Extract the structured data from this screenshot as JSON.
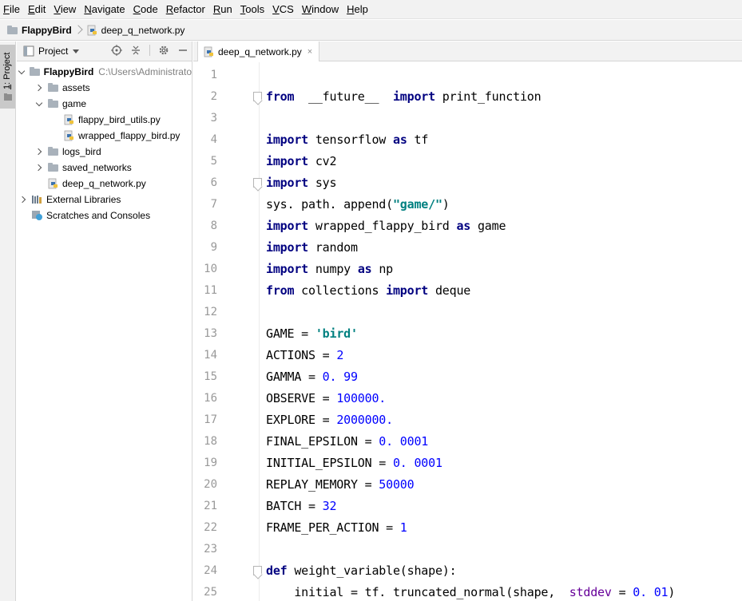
{
  "menu": [
    {
      "label": "File",
      "mn": "F",
      "rest": "ile"
    },
    {
      "label": "Edit",
      "mn": "E",
      "rest": "dit"
    },
    {
      "label": "View",
      "mn": "V",
      "rest": "iew"
    },
    {
      "label": "Navigate",
      "mn": "N",
      "rest": "avigate"
    },
    {
      "label": "Code",
      "mn": "C",
      "rest": "ode"
    },
    {
      "label": "Refactor",
      "mn": "R",
      "rest": "efactor"
    },
    {
      "label": "Run",
      "mn": "R",
      "rest": "un"
    },
    {
      "label": "Tools",
      "mn": "T",
      "rest": "ools"
    },
    {
      "label": "VCS",
      "mn": "V",
      "rest": "CS"
    },
    {
      "label": "Window",
      "mn": "W",
      "rest": "indow"
    },
    {
      "label": "Help",
      "mn": "H",
      "rest": "elp"
    }
  ],
  "breadcrumb": {
    "project": "FlappyBird",
    "file": "deep_q_network.py"
  },
  "left_stripe": {
    "tab_number": "1",
    "tab_label": ": Project"
  },
  "project_panel": {
    "title": "Project",
    "tree": [
      {
        "label": "FlappyBird",
        "hint": "C:\\Users\\Administrato",
        "type": "root",
        "expanded": true,
        "depth": 0
      },
      {
        "label": "assets",
        "type": "folder",
        "expanded": false,
        "depth": 1
      },
      {
        "label": "game",
        "type": "folder",
        "expanded": true,
        "depth": 1
      },
      {
        "label": "flappy_bird_utils.py",
        "type": "pyfile",
        "depth": 2
      },
      {
        "label": "wrapped_flappy_bird.py",
        "type": "pyfile",
        "depth": 2
      },
      {
        "label": "logs_bird",
        "type": "folder",
        "expanded": false,
        "depth": 1
      },
      {
        "label": "saved_networks",
        "type": "folder",
        "expanded": false,
        "depth": 1
      },
      {
        "label": "deep_q_network.py",
        "type": "pyfile",
        "depth": 1
      },
      {
        "label": "External Libraries",
        "type": "libs",
        "expanded": false,
        "depth": 0
      },
      {
        "label": "Scratches and Consoles",
        "type": "scratch",
        "depth": 0
      }
    ]
  },
  "editor": {
    "tab_label": "deep_q_network.py",
    "tab_close": "×",
    "lines": [
      {
        "n": "1",
        "tokens": []
      },
      {
        "n": "2",
        "fold": true,
        "tokens": [
          [
            "kw",
            "from"
          ],
          [
            "",
            "  __future__  "
          ],
          [
            "kw",
            "import"
          ],
          [
            "",
            " print_function"
          ]
        ]
      },
      {
        "n": "3",
        "tokens": []
      },
      {
        "n": "4",
        "tokens": [
          [
            "kw",
            "import"
          ],
          [
            "",
            " tensorflow "
          ],
          [
            "kw",
            "as"
          ],
          [
            "",
            " tf"
          ]
        ]
      },
      {
        "n": "5",
        "tokens": [
          [
            "kw",
            "import"
          ],
          [
            "",
            " cv2"
          ]
        ]
      },
      {
        "n": "6",
        "fold": true,
        "tokens": [
          [
            "kw",
            "import"
          ],
          [
            "",
            " sys"
          ]
        ]
      },
      {
        "n": "7",
        "tokens": [
          [
            "",
            "sys. path. append("
          ],
          [
            "str",
            "\"game/\""
          ],
          [
            "",
            ")"
          ]
        ]
      },
      {
        "n": "8",
        "tokens": [
          [
            "kw",
            "import"
          ],
          [
            "",
            " wrapped_flappy_bird "
          ],
          [
            "kw",
            "as"
          ],
          [
            "",
            " game"
          ]
        ]
      },
      {
        "n": "9",
        "tokens": [
          [
            "kw",
            "import"
          ],
          [
            "",
            " random"
          ]
        ]
      },
      {
        "n": "10",
        "tokens": [
          [
            "kw",
            "import"
          ],
          [
            "",
            " numpy "
          ],
          [
            "kw",
            "as"
          ],
          [
            "",
            " np"
          ]
        ]
      },
      {
        "n": "11",
        "tokens": [
          [
            "kw",
            "from"
          ],
          [
            "",
            " collections "
          ],
          [
            "kw",
            "import"
          ],
          [
            "",
            " deque"
          ]
        ]
      },
      {
        "n": "12",
        "tokens": []
      },
      {
        "n": "13",
        "tokens": [
          [
            "",
            "GAME = "
          ],
          [
            "str",
            "'bird'"
          ]
        ]
      },
      {
        "n": "14",
        "tokens": [
          [
            "",
            "ACTIONS = "
          ],
          [
            "num",
            "2"
          ]
        ]
      },
      {
        "n": "15",
        "tokens": [
          [
            "",
            "GAMMA = "
          ],
          [
            "num",
            "0. 99"
          ]
        ]
      },
      {
        "n": "16",
        "tokens": [
          [
            "",
            "OBSERVE = "
          ],
          [
            "num",
            "100000."
          ]
        ]
      },
      {
        "n": "17",
        "tokens": [
          [
            "",
            "EXPLORE = "
          ],
          [
            "num",
            "2000000."
          ]
        ]
      },
      {
        "n": "18",
        "tokens": [
          [
            "",
            "FINAL_EPSILON = "
          ],
          [
            "num",
            "0. 0001"
          ]
        ]
      },
      {
        "n": "19",
        "tokens": [
          [
            "",
            "INITIAL_EPSILON = "
          ],
          [
            "num",
            "0. 0001"
          ]
        ]
      },
      {
        "n": "20",
        "tokens": [
          [
            "",
            "REPLAY_MEMORY = "
          ],
          [
            "num",
            "50000"
          ]
        ]
      },
      {
        "n": "21",
        "tokens": [
          [
            "",
            "BATCH = "
          ],
          [
            "num",
            "32"
          ]
        ]
      },
      {
        "n": "22",
        "tokens": [
          [
            "",
            "FRAME_PER_ACTION = "
          ],
          [
            "num",
            "1"
          ]
        ]
      },
      {
        "n": "23",
        "tokens": []
      },
      {
        "n": "24",
        "fold": true,
        "tokens": [
          [
            "kw",
            "def"
          ],
          [
            "",
            " weight_variable(shape):"
          ]
        ]
      },
      {
        "n": "25",
        "tokens": [
          [
            "",
            "    initial = tf. truncated_normal(shape,  "
          ],
          [
            "kwarg",
            "stddev"
          ],
          [
            "",
            " = "
          ],
          [
            "num",
            "0. 01"
          ],
          [
            "",
            ")"
          ]
        ]
      }
    ]
  }
}
